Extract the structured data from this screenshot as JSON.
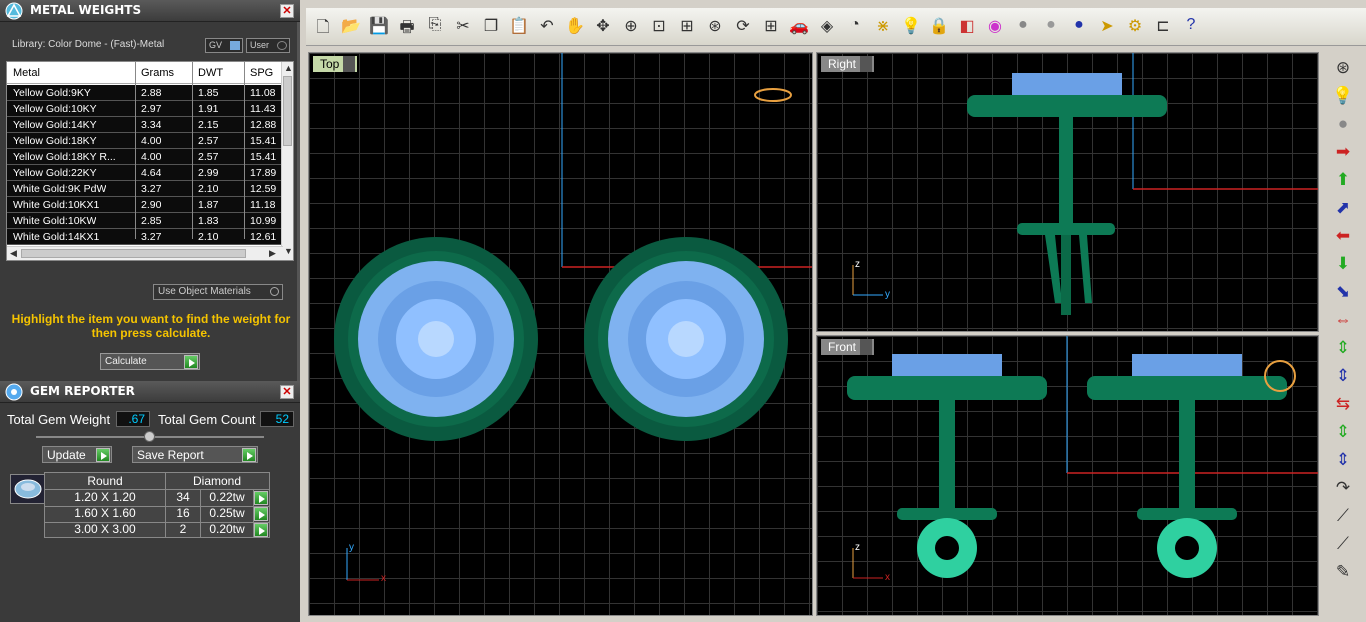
{
  "metal_weights": {
    "title": "METAL WEIGHTS",
    "library": "Library: Color Dome - (Fast)-Metal",
    "toggle_gv": "GV",
    "toggle_user": "User",
    "columns": [
      "Metal",
      "Grams",
      "DWT",
      "SPG"
    ],
    "rows": [
      [
        "Yellow Gold:9KY",
        "2.88",
        "1.85",
        "11.08"
      ],
      [
        "Yellow Gold:10KY",
        "2.97",
        "1.91",
        "11.43"
      ],
      [
        "Yellow Gold:14KY",
        "3.34",
        "2.15",
        "12.88"
      ],
      [
        "Yellow Gold:18KY",
        "4.00",
        "2.57",
        "15.41"
      ],
      [
        "Yellow Gold:18KY R...",
        "4.00",
        "2.57",
        "15.41"
      ],
      [
        "Yellow Gold:22KY",
        "4.64",
        "2.99",
        "17.89"
      ],
      [
        "White Gold:9K PdW",
        "3.27",
        "2.10",
        "12.59"
      ],
      [
        "White Gold:10KX1",
        "2.90",
        "1.87",
        "11.18"
      ],
      [
        "White Gold:10KW",
        "2.85",
        "1.83",
        "10.99"
      ],
      [
        "White Gold:14KX1",
        "3.27",
        "2.10",
        "12.61"
      ]
    ],
    "use_object_materials": "Use Object Materials",
    "hint": "Highlight the item you want to find the weight for then press calculate.",
    "calculate": "Calculate"
  },
  "gem_reporter": {
    "title": "GEM REPORTER",
    "total_weight_label": "Total Gem Weight",
    "total_weight_value": ".67",
    "total_count_label": "Total Gem Count",
    "total_count_value": "52",
    "update": "Update",
    "save_report": "Save Report",
    "shape": "Round",
    "material": "Diamond",
    "gems": [
      [
        "1.20 X 1.20",
        "34",
        "0.22tw"
      ],
      [
        "1.60 X 1.60",
        "16",
        "0.25tw"
      ],
      [
        "3.00 X 3.00",
        "2",
        "0.20tw"
      ]
    ]
  },
  "viewports": {
    "top": "Top",
    "right": "Right",
    "front": "Front",
    "axis_x": "x",
    "axis_y": "y",
    "axis_z": "z"
  },
  "toolbar_icons": [
    "new-icon",
    "open-icon",
    "save-icon",
    "print-icon",
    "copy-file-icon",
    "cut-icon",
    "copy-icon",
    "paste-icon",
    "undo-icon",
    "pan-hand-icon",
    "move-icon",
    "zoom-in-icon",
    "zoom-window-icon",
    "zoom-extents-icon",
    "zoom-dynamic-icon",
    "rotate-view-icon",
    "viewport-layout-icon",
    "car-icon",
    "gumball-icon",
    "gauge-icon",
    "snap-icon",
    "light-bulb-icon",
    "lock-icon",
    "layer-icon",
    "color-wheel-icon",
    "sphere-icon",
    "sphere-grey-icon",
    "sphere-blue-icon",
    "pointer-icon",
    "gear-icon",
    "dimension-icon",
    "help-icon"
  ]
}
